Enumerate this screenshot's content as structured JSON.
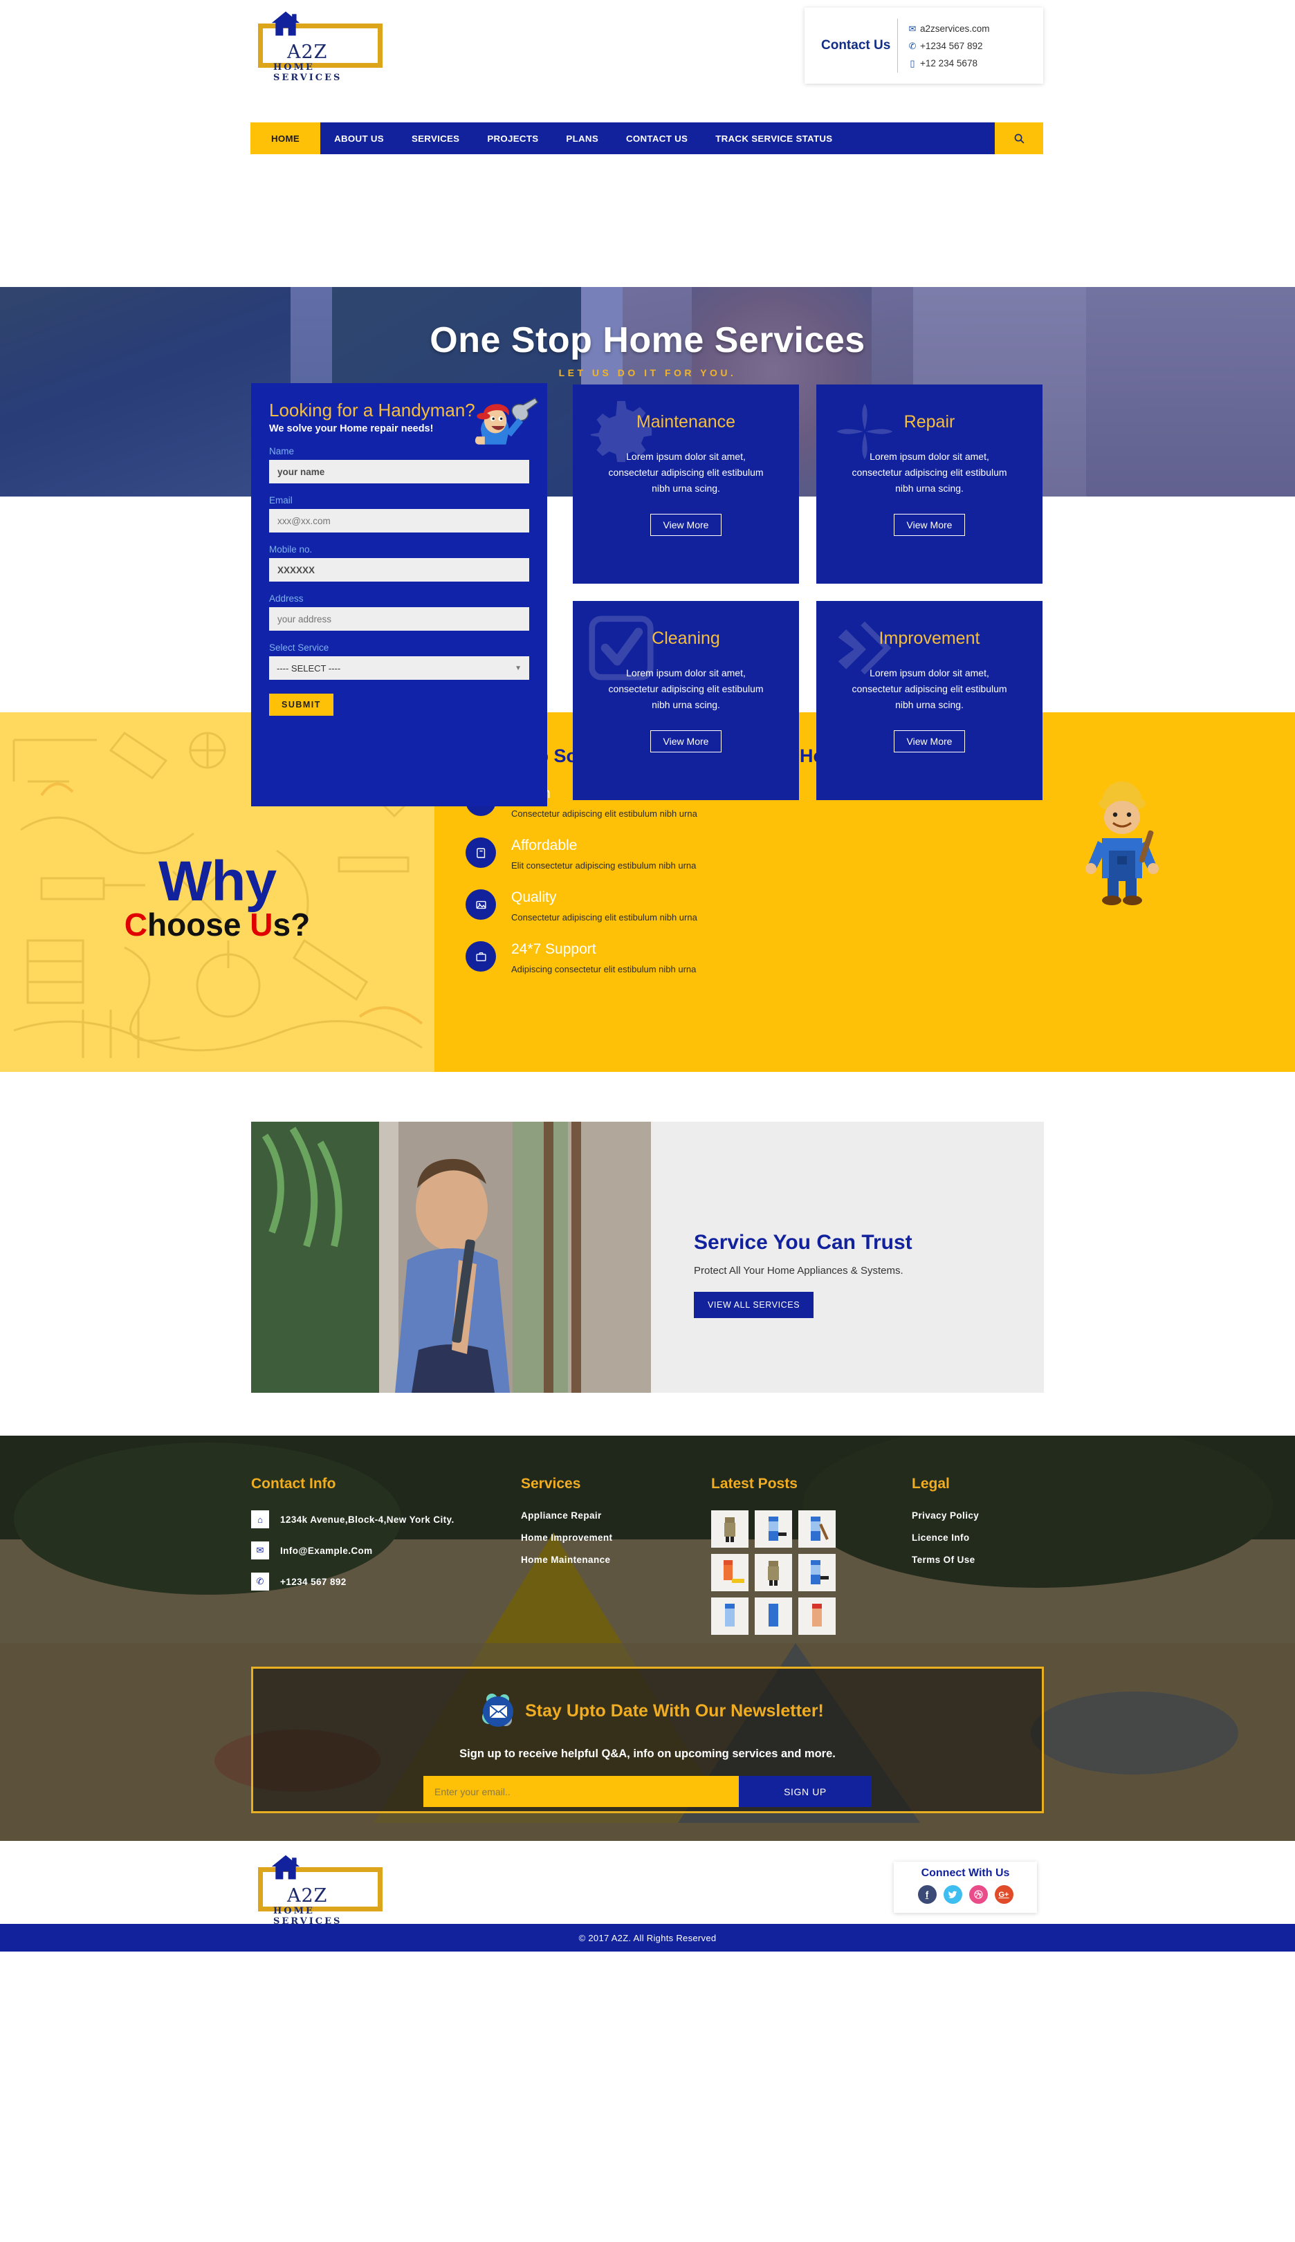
{
  "brand": {
    "name": "A2Z",
    "tagline": "HOME SERVICES",
    "house_icon": "house-icon"
  },
  "header": {
    "contact_title": "Contact Us",
    "contact_items": [
      {
        "icon": "envelope-icon",
        "text": "a2zservices.com"
      },
      {
        "icon": "phone-icon",
        "text": "+1234 567 892"
      },
      {
        "icon": "mobile-icon",
        "text": "+12 234 5678"
      }
    ]
  },
  "nav": {
    "items": [
      {
        "label": "HOME",
        "active": true
      },
      {
        "label": "ABOUT US",
        "active": false
      },
      {
        "label": "SERVICES",
        "active": false
      },
      {
        "label": "PROJECTS",
        "active": false
      },
      {
        "label": "PLANS",
        "active": false
      },
      {
        "label": "CONTACT US",
        "active": false
      },
      {
        "label": "TRACK SERVICE STATUS",
        "active": false
      }
    ],
    "search_icon": "search-icon"
  },
  "hero": {
    "title": "One Stop Home Services",
    "subtitle": "LET US DO IT FOR YOU."
  },
  "form": {
    "title": "Looking for a Handyman?",
    "tagline": "We solve your Home repair needs!",
    "fields": [
      {
        "label": "Name",
        "value": "your name",
        "placeholder": "your name"
      },
      {
        "label": "Email",
        "value": "",
        "placeholder": "xxx@xx.com"
      },
      {
        "label": "Mobile no.",
        "value": "XXXXXX",
        "placeholder": "XXXXXX"
      },
      {
        "label": "Address",
        "value": "",
        "placeholder": "your address"
      }
    ],
    "select_label": "Select Service",
    "select_value": "---- SELECT ----",
    "select_options": [
      "---- SELECT ----",
      "Maintenance",
      "Repair",
      "Cleaning",
      "Improvement"
    ],
    "submit_label": "SUBMIT"
  },
  "services": {
    "body": "Lorem ipsum dolor sit amet, consectetur adipiscing elit estibulum nibh urna scing.",
    "button_label": "View More",
    "cards": [
      {
        "title": "Maintenance",
        "icon": "gear-icon"
      },
      {
        "title": "Repair",
        "icon": "fan-icon"
      },
      {
        "title": "Cleaning",
        "icon": "check-square-icon"
      },
      {
        "title": "Improvement",
        "icon": "chevron-diamond-icon"
      }
    ]
  },
  "why": {
    "word1": "Why",
    "word2_parts": [
      {
        "text": "C",
        "color": "#e00000"
      },
      {
        "text": "hoose ",
        "color": "#111111"
      },
      {
        "text": "U",
        "color": "#e00000"
      },
      {
        "text": "s?",
        "color": "#111111"
      }
    ],
    "heading": "One Stop Solution for your Complete Home Maintenance",
    "features": [
      {
        "icon": "check-circle-icon",
        "title": "Vision",
        "desc": "Consectetur adipiscing elit estibulum nibh urna"
      },
      {
        "icon": "book-icon",
        "title": "Affordable",
        "desc": "Elit consectetur adipiscing estibulum nibh urna"
      },
      {
        "icon": "image-icon",
        "title": "Quality",
        "desc": "Consectetur adipiscing elit estibulum nibh urna"
      },
      {
        "icon": "briefcase-icon",
        "title": "24*7 Support",
        "desc": "Adipiscing consectetur elit estibulum nibh urna"
      }
    ]
  },
  "trust": {
    "title": "Service You Can Trust",
    "subtitle": "Protect All Your Home Appliances & Systems.",
    "button_label": "VIEW ALL SERVICES"
  },
  "footer": {
    "contact": {
      "heading": "Contact Info",
      "items": [
        {
          "icon": "home-icon",
          "text": "1234k Avenue,Block-4,New York City."
        },
        {
          "icon": "envelope-icon",
          "text": "Info@Example.Com"
        },
        {
          "icon": "phone-icon",
          "text": "+1234 567 892"
        }
      ]
    },
    "services": {
      "heading": "Services",
      "items": [
        "Appliance Repair",
        "Home Improvement",
        "Home Maintenance"
      ]
    },
    "posts": {
      "heading": "Latest Posts",
      "count": 9
    },
    "legal": {
      "heading": "Legal",
      "items": [
        "Privacy Policy",
        "Licence Info",
        "Terms Of Use"
      ]
    }
  },
  "newsletter": {
    "icon": "envelope-icon",
    "title": "Stay Upto Date With Our Newsletter!",
    "subtitle": "Sign up to receive helpful Q&A, info on upcoming services and more.",
    "placeholder": "Enter your email..",
    "value": "",
    "button_label": "SIGN UP"
  },
  "connect": {
    "heading": "Connect With Us",
    "socials": [
      {
        "name": "facebook-icon",
        "glyph": "f",
        "color": "#3b4a77"
      },
      {
        "name": "twitter-icon",
        "glyph": "t",
        "color": "#3dbdf0"
      },
      {
        "name": "dribbble-icon",
        "glyph": "d",
        "color": "#ea4c89"
      },
      {
        "name": "google-plus-icon",
        "glyph": "G+",
        "color": "#e04b2a"
      }
    ]
  },
  "copyright": "© 2017 A2Z. All Rights Reserved",
  "colors": {
    "blue": "#11229c",
    "yellow": "#ffc107",
    "gold": "#f0ad22",
    "navy": "#122d86"
  }
}
